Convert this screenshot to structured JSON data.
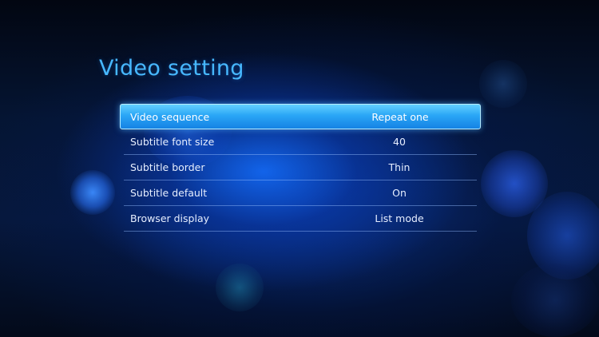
{
  "page": {
    "title": "Video setting"
  },
  "settings": [
    {
      "label": "Video sequence",
      "value": "Repeat one",
      "selected": true
    },
    {
      "label": "Subtitle font size",
      "value": "40",
      "selected": false
    },
    {
      "label": "Subtitle border",
      "value": "Thin",
      "selected": false
    },
    {
      "label": "Subtitle default",
      "value": "On",
      "selected": false
    },
    {
      "label": "Browser display",
      "value": "List mode",
      "selected": false
    }
  ],
  "colors": {
    "title": "#47b8ff",
    "highlight": "#2aa6f6",
    "background": "#06183c"
  }
}
